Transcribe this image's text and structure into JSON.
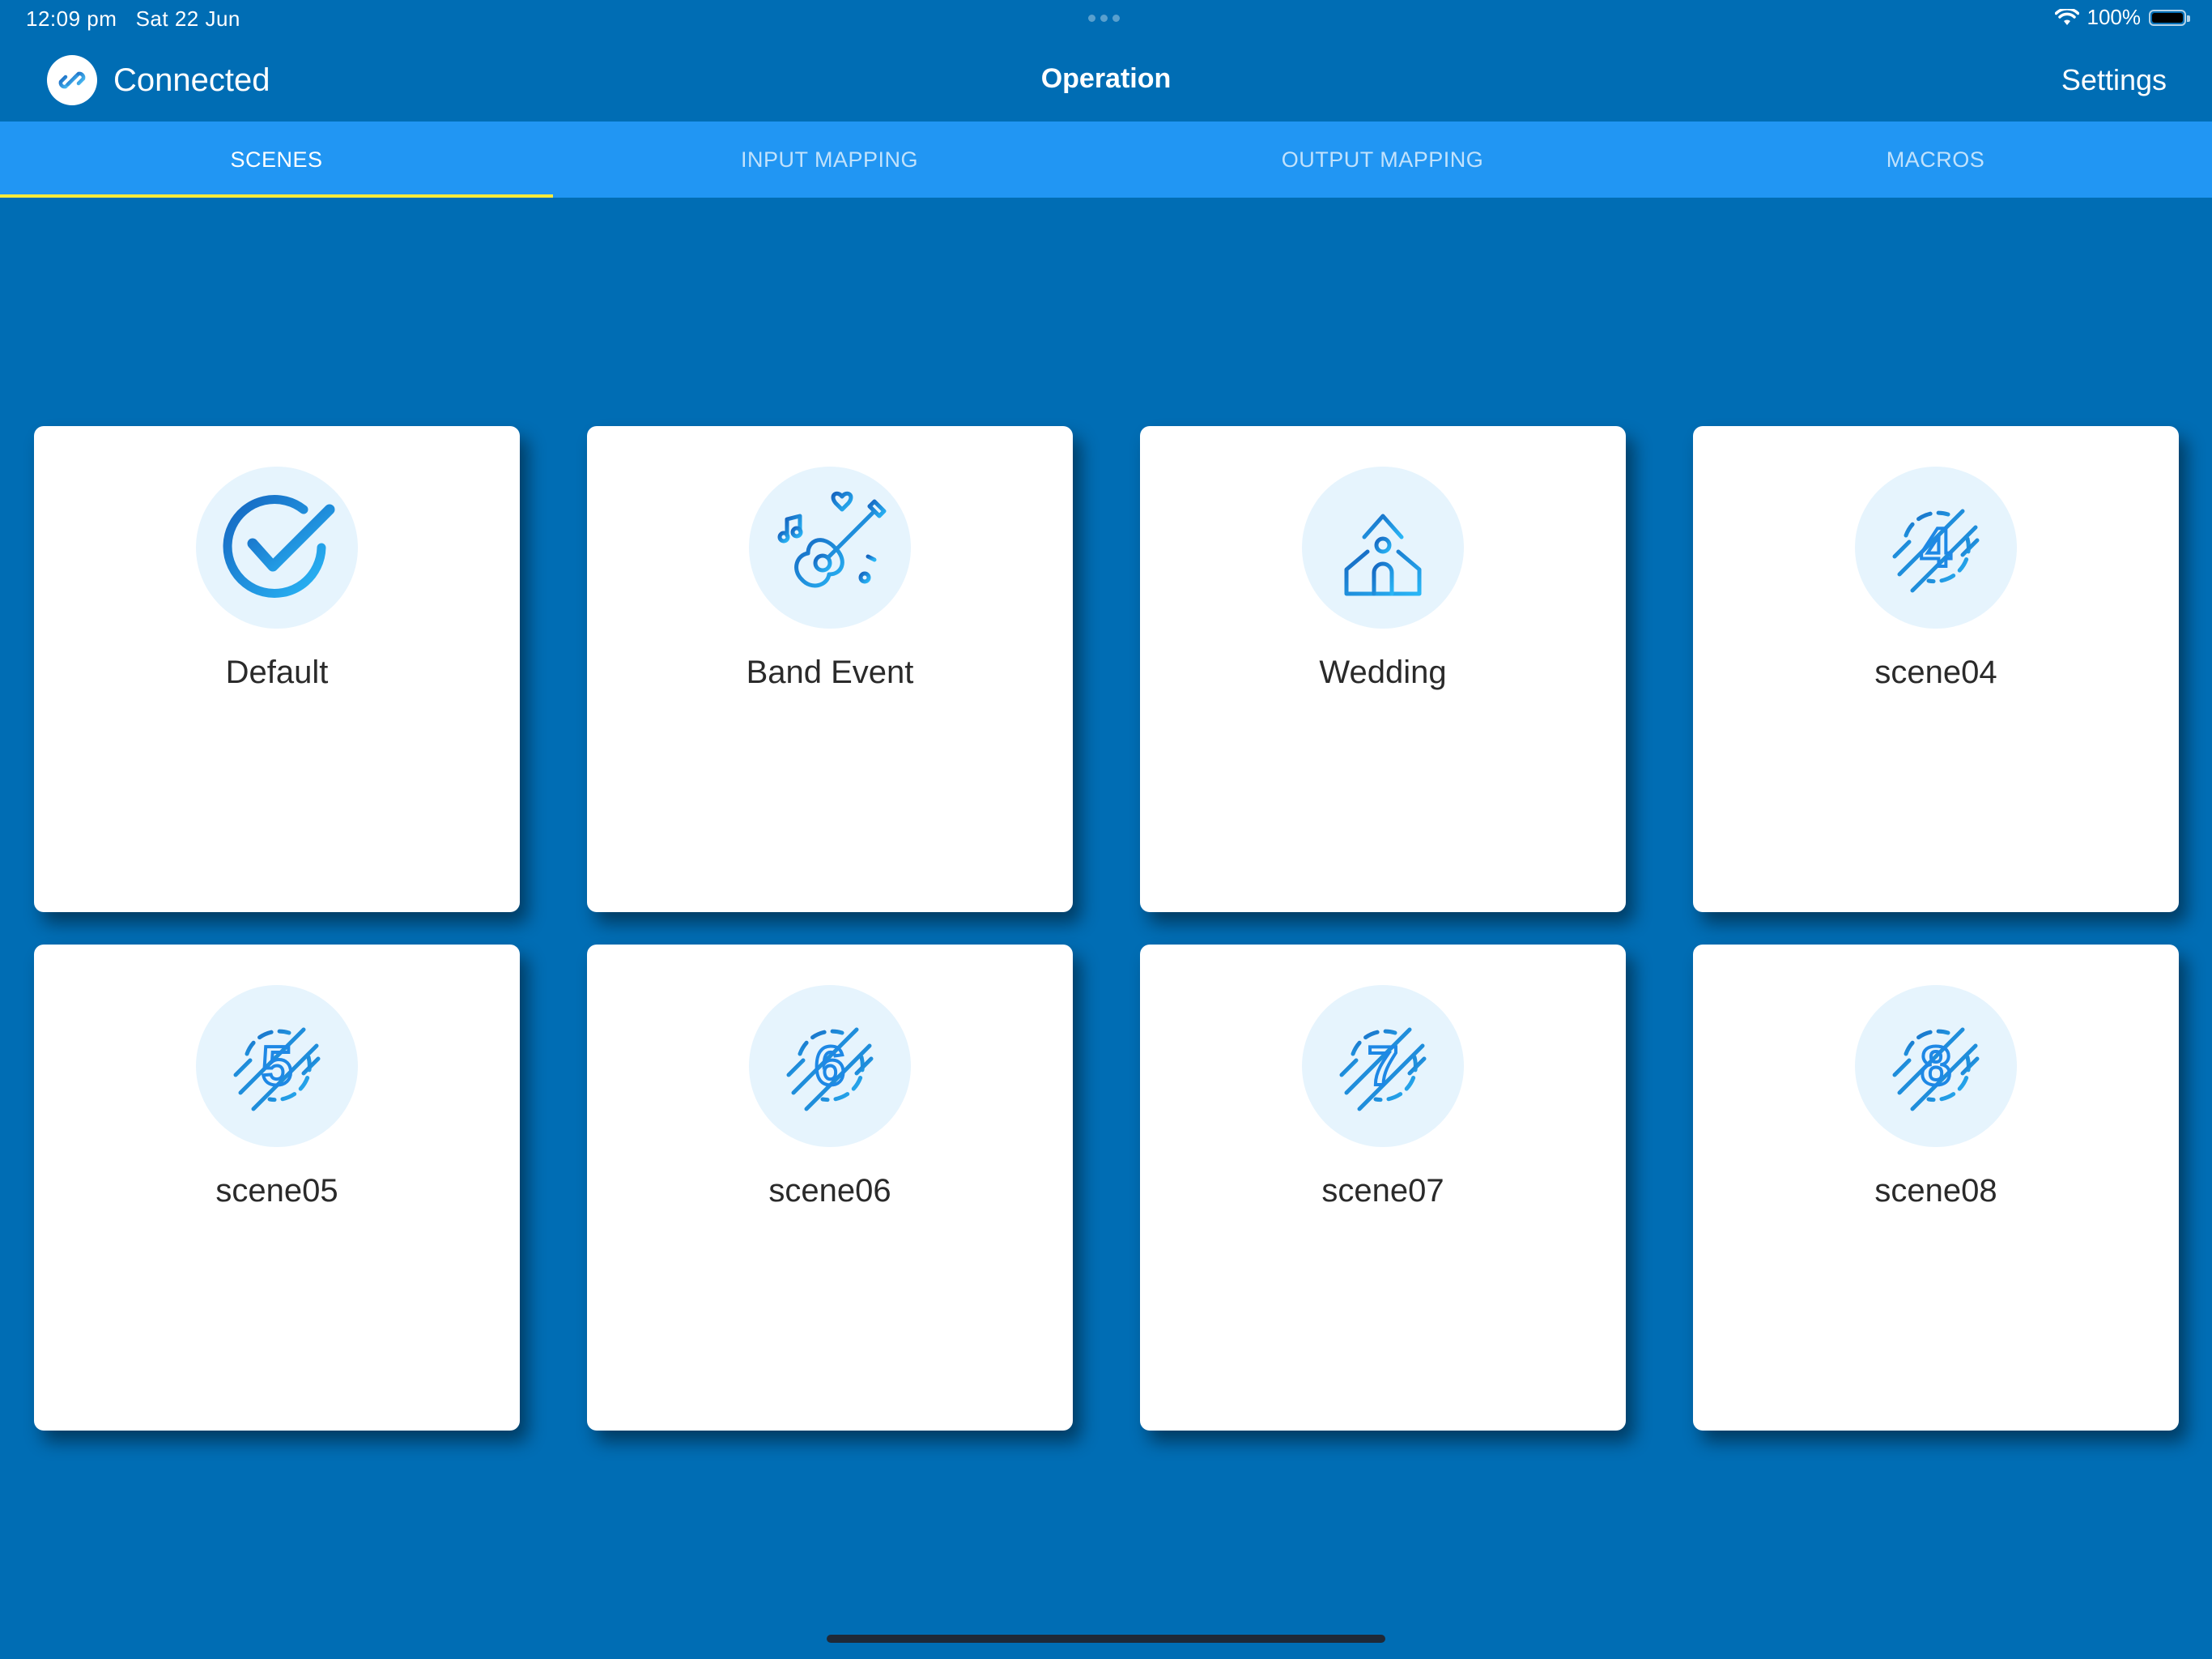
{
  "status_bar": {
    "time": "12:09 pm",
    "date": "Sat 22 Jun",
    "battery": "100%",
    "battery_level": 1.0,
    "wifi_icon": "wifi-icon"
  },
  "nav": {
    "connection_label": "Connected",
    "connection_icon": "link-icon",
    "title": "Operation",
    "settings_label": "Settings"
  },
  "tabs": [
    {
      "label": "SCENES",
      "active": true
    },
    {
      "label": "INPUT MAPPING",
      "active": false
    },
    {
      "label": "OUTPUT MAPPING",
      "active": false
    },
    {
      "label": "MACROS",
      "active": false
    }
  ],
  "scenes": [
    {
      "label": "Default",
      "icon": "checkmark-icon"
    },
    {
      "label": "Band Event",
      "icon": "guitar-icon"
    },
    {
      "label": "Wedding",
      "icon": "church-icon"
    },
    {
      "label": "scene04",
      "icon": "number-4-icon",
      "number": "4"
    },
    {
      "label": "scene05",
      "icon": "number-5-icon",
      "number": "5"
    },
    {
      "label": "scene06",
      "icon": "number-6-icon",
      "number": "6"
    },
    {
      "label": "scene07",
      "icon": "number-7-icon",
      "number": "7"
    },
    {
      "label": "scene08",
      "icon": "number-8-icon",
      "number": "8"
    }
  ],
  "colors": {
    "background": "#006DB4",
    "tab_bar": "#2196F3",
    "tab_indicator": "#FFEB3B",
    "icon_stroke_dark": "#1976C8",
    "icon_stroke_light": "#29B6F6",
    "icon_circle": "#E6F4FD"
  }
}
